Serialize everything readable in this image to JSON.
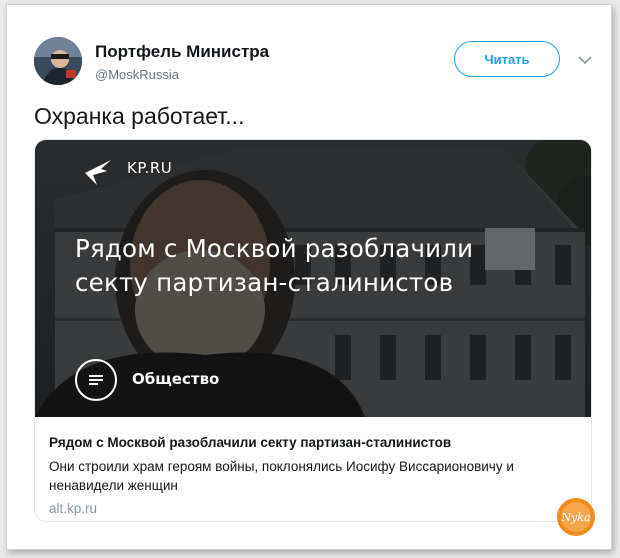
{
  "tweet": {
    "author_name": "Портфель Министра",
    "author_handle": "@MoskRussia",
    "follow_label": "Читать",
    "text": "Охранка работает..."
  },
  "card": {
    "image": {
      "brand": "KP.RU",
      "headline_line1": "Рядом с Москвой разоблачили",
      "headline_line2": "секту партизан-сталинистов",
      "rubric": "Общество"
    },
    "title": "Рядом с Москвой разоблачили секту партизан-сталинистов",
    "description": "Они строили храм героям войны, поклонялись Иосифу Виссарионовичу и ненавидели женщин",
    "domain": "alt.kp.ru"
  },
  "watermark": {
    "text": "Nyka"
  },
  "colors": {
    "accent": "#1da1f2",
    "muted": "#657786",
    "domain": "#8899a6",
    "watermark": "#f08a1c"
  },
  "icons": {
    "avatar": "avatar",
    "caret": "chevron-down-icon",
    "kp": "kp-bird-logo-icon",
    "rubric": "list-lines-icon"
  }
}
